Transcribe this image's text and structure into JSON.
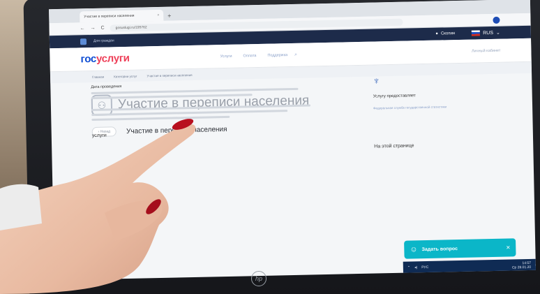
{
  "browser": {
    "tab_title": "Участие в переписи населения",
    "tab_close": "×",
    "new_tab": "+",
    "back": "←",
    "forward": "→",
    "reload": "C",
    "url": "gosuslugi.ru/195762"
  },
  "site_top": {
    "audience": "Для граждан",
    "location": "Скопин",
    "language": "RUS"
  },
  "header": {
    "logo_part1": "гос",
    "logo_part2": "услуги",
    "menu": [
      "Услуги",
      "Оплата",
      "Поддержка"
    ],
    "login": "Личный кабинет"
  },
  "breadcrumbs": [
    "Главная",
    "Категории услуг",
    "Участие в переписи населения"
  ],
  "page": {
    "title": "Участие в переписи населения",
    "back_label": "‹ Назад",
    "subtitle": "Участие в переписи населения",
    "date_label": "Дата проведения",
    "services_heading": "услуги"
  },
  "sidebar": {
    "provider_label": "Услугу предоставляет",
    "provider_name": "Федеральная служба государственной статистики",
    "on_page": "На этой странице"
  },
  "chat": {
    "label": "Задать вопрос",
    "close": "×"
  },
  "taskbar": {
    "lang": "РУС",
    "time": "14:57",
    "date": "Ср 28.01.20"
  },
  "laptop": {
    "brand": "hp"
  },
  "colors": {
    "brand_blue": "#0d4cd3",
    "brand_red": "#ee3f58",
    "chat_teal": "#0bb6c8",
    "top_bar": "#1d2b4a",
    "nail": "#b8101f"
  }
}
